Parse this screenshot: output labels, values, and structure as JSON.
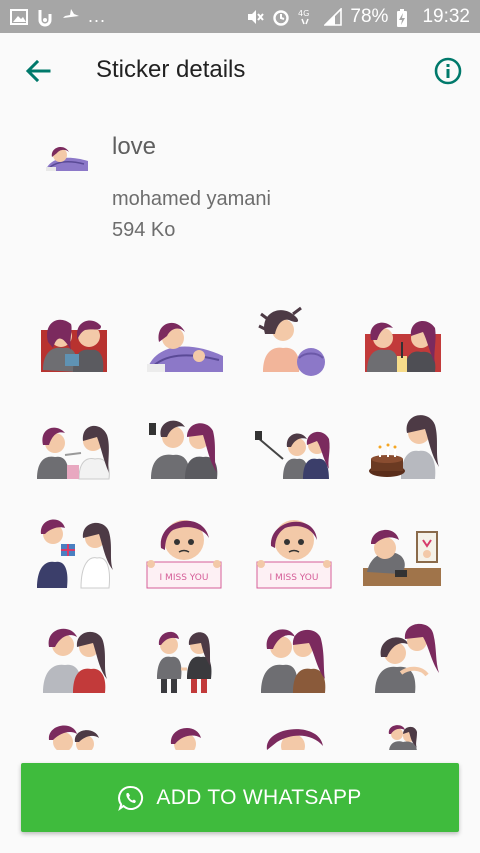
{
  "status_bar": {
    "battery": "78%",
    "time": "19:32",
    "network": "4G",
    "overflow": "..."
  },
  "app_bar": {
    "title": "Sticker details",
    "back_icon": "arrow-back-icon",
    "info_icon": "info-icon"
  },
  "pack": {
    "name": "love",
    "author": "mohamed yamani",
    "size": "594 Ko"
  },
  "stickers": [
    {
      "name": "sticker-couple-phone"
    },
    {
      "name": "sticker-girl-blanket"
    },
    {
      "name": "sticker-girl-ball"
    },
    {
      "name": "sticker-couple-drink"
    },
    {
      "name": "sticker-couple-spoon"
    },
    {
      "name": "sticker-couple-selfie"
    },
    {
      "name": "sticker-couple-selfie-stick"
    },
    {
      "name": "sticker-girl-cake"
    },
    {
      "name": "sticker-boy-gift"
    },
    {
      "name": "sticker-girl-miss-you",
      "text": "I MISS YOU"
    },
    {
      "name": "sticker-boy-miss-you",
      "text": "I MISS YOU"
    },
    {
      "name": "sticker-boy-desk"
    },
    {
      "name": "sticker-couple-hug"
    },
    {
      "name": "sticker-couple-hands"
    },
    {
      "name": "sticker-couple-kiss"
    },
    {
      "name": "sticker-couple-embrace"
    },
    {
      "name": "sticker-partial-1"
    },
    {
      "name": "sticker-partial-2"
    },
    {
      "name": "sticker-partial-3"
    },
    {
      "name": "sticker-partial-4"
    }
  ],
  "action": {
    "label": "ADD TO WHATSAPP",
    "icon": "whatsapp-icon"
  },
  "colors": {
    "accent": "#00796b",
    "button": "#3fbb3d",
    "status_bar": "#a6a6a6",
    "hair": "#7b2a5e",
    "skin": "#f3c9a8",
    "blanket": "#8c78c8",
    "shirt_red": "#c23a3a",
    "shirt_gray": "#6e6e72"
  }
}
